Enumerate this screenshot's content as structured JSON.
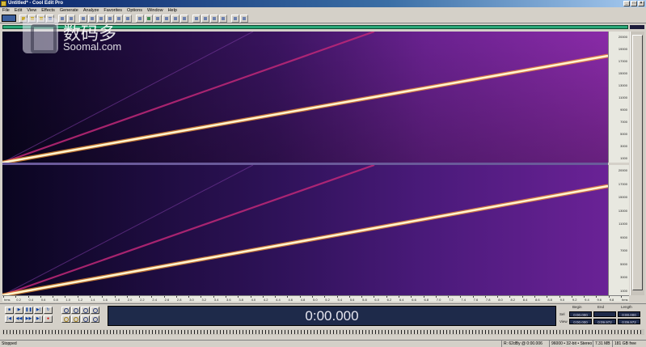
{
  "window": {
    "title": "Untitled* - Cool Edit Pro"
  },
  "menu": [
    "File",
    "Edit",
    "View",
    "Effects",
    "Generate",
    "Analyze",
    "Favorites",
    "Options",
    "Window",
    "Help"
  ],
  "watermark": {
    "cn": "数码多",
    "en": "Soomal.com"
  },
  "freq_ruler_top": [
    "20000",
    "19000",
    "17000",
    "15000",
    "13000",
    "11000",
    "9000",
    "7000",
    "5000",
    "3000",
    "1000"
  ],
  "freq_ruler_bot": [
    "20000",
    "17000",
    "15000",
    "13000",
    "11000",
    "9000",
    "7000",
    "5000",
    "3000",
    "1000"
  ],
  "time_ruler": [
    "hms",
    "0.2",
    "0.4",
    "0.6",
    "0.8",
    "1.0",
    "1.2",
    "1.4",
    "1.6",
    "1.8",
    "2.0",
    "2.2",
    "2.4",
    "2.6",
    "2.8",
    "3.0",
    "3.2",
    "3.4",
    "3.6",
    "3.8",
    "4.0",
    "4.2",
    "4.4",
    "4.6",
    "4.8",
    "5.0",
    "5.2",
    "5.4",
    "5.6",
    "5.8",
    "6.0",
    "6.2",
    "6.4",
    "6.6",
    "6.8",
    "7.0",
    "7.2",
    "7.4",
    "7.6",
    "7.8",
    "8.0",
    "8.2",
    "8.4",
    "8.6",
    "8.8",
    "9.0",
    "9.2",
    "9.4",
    "9.6",
    "9.8",
    "hms"
  ],
  "transport": {
    "time_display": "0:00.000"
  },
  "selection": {
    "headers": {
      "begin": "Begin",
      "end": "End",
      "length": "Length"
    },
    "rows": [
      {
        "label": "Sel",
        "begin": "0:00.000",
        "end": "",
        "length": "0:00.000"
      },
      {
        "label": "View",
        "begin": "0:00.000",
        "end": "0:09.972",
        "length": "0:09.972"
      }
    ]
  },
  "status": {
    "left": "Stopped",
    "cells": [
      "R: 62dBy @ 0:00.006",
      "96000 • 32-bit • Stereo",
      "7.31 MB",
      "181 GB free"
    ]
  },
  "colors": {
    "accent": "#2aa878",
    "spectrum_bg": "#100826",
    "sweep": "#fff4c8"
  }
}
